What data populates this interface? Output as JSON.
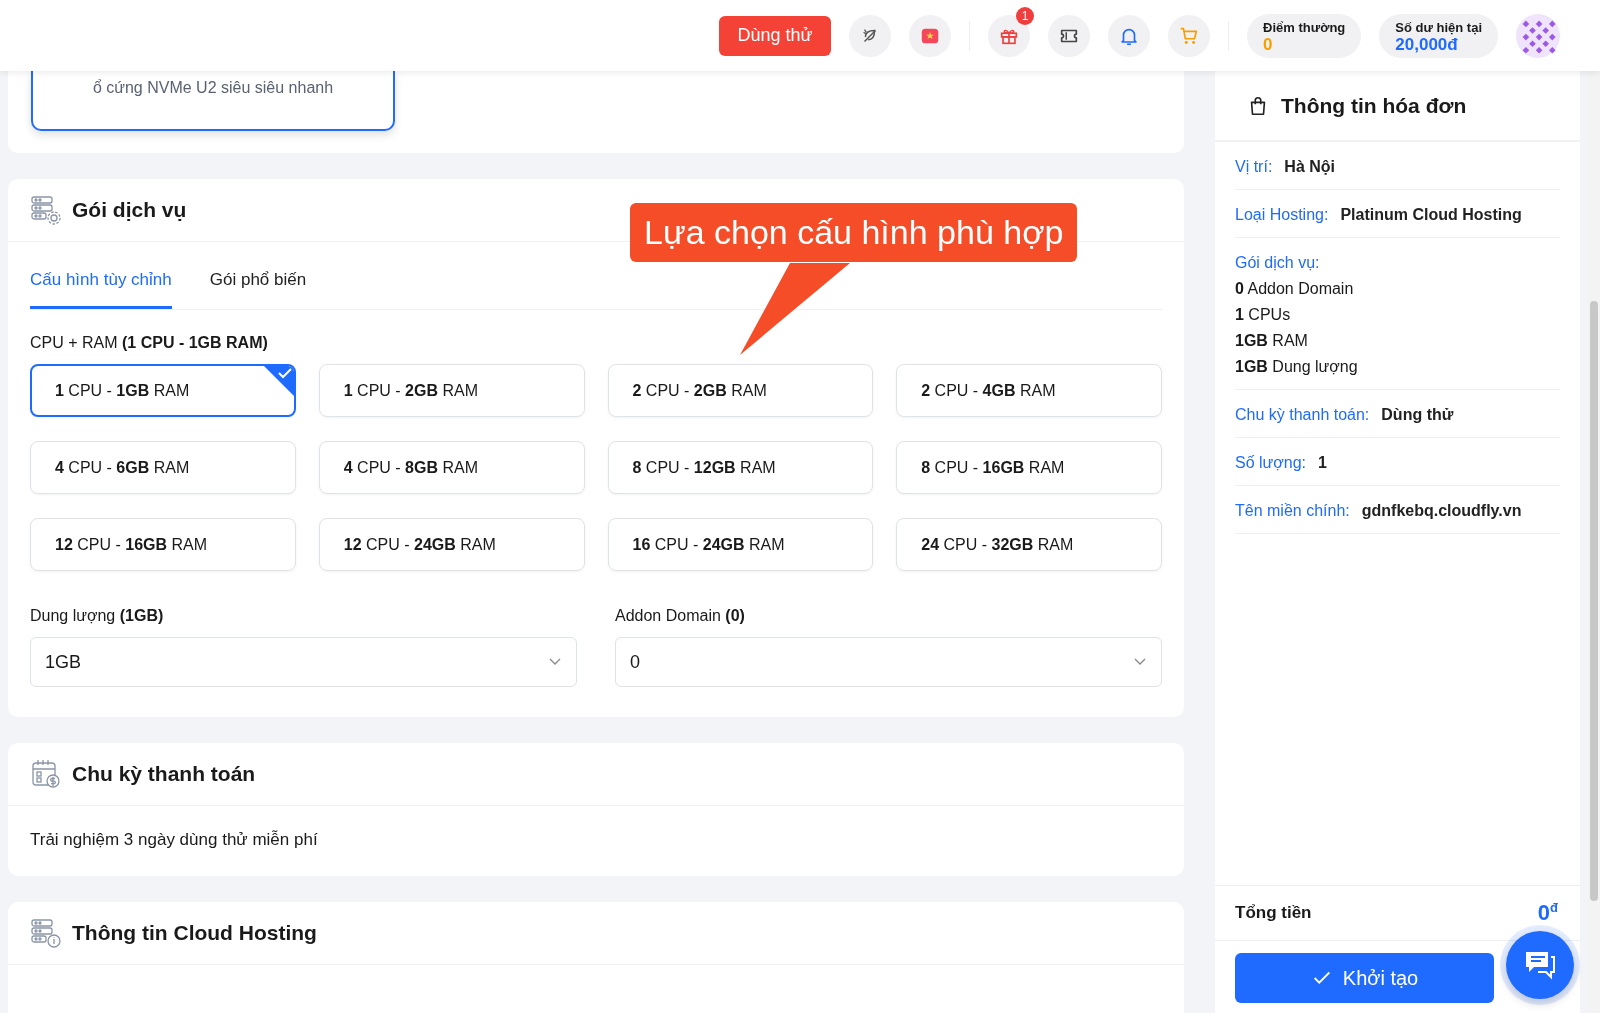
{
  "header": {
    "trial_button": "Dùng thử",
    "gift_badge": "1",
    "points": {
      "label": "Điểm thường",
      "value": "0"
    },
    "balance": {
      "label": "Số dư hiện tại",
      "value": "20,000đ"
    }
  },
  "top_card": {
    "description": "ổ cứng NVMe U2 siêu siêu nhanh"
  },
  "service_package": {
    "title": "Gói dịch vụ",
    "tabs": [
      {
        "label": "Cấu hình tùy chỉnh",
        "selected": true
      },
      {
        "label": "Gói phổ biến",
        "selected": false
      }
    ],
    "cpu_ram_label": "CPU + RAM **(1 CPU - 1GB RAM)**",
    "options": [
      {
        "label": "**1** CPU - **1GB** RAM",
        "selected": true
      },
      {
        "label": "**1** CPU - **2GB** RAM",
        "selected": false
      },
      {
        "label": "**2** CPU - **2GB** RAM",
        "selected": false
      },
      {
        "label": "**2** CPU - **4GB** RAM",
        "selected": false
      },
      {
        "label": "**4** CPU - **6GB** RAM",
        "selected": false
      },
      {
        "label": "**4** CPU - **8GB** RAM",
        "selected": false
      },
      {
        "label": "**8** CPU - **12GB** RAM",
        "selected": false
      },
      {
        "label": "**8** CPU - **16GB** RAM",
        "selected": false
      },
      {
        "label": "**12** CPU - **16GB** RAM",
        "selected": false
      },
      {
        "label": "**12** CPU - **24GB** RAM",
        "selected": false
      },
      {
        "label": "**16** CPU - **24GB** RAM",
        "selected": false
      },
      {
        "label": "**24** CPU - **32GB** RAM",
        "selected": false
      }
    ],
    "storage": {
      "label": "Dung lượng **(1GB)**",
      "value": "1GB"
    },
    "addon": {
      "label": "Addon Domain **(0)**",
      "value": "0"
    }
  },
  "callout": "Lựa chọn cấu hình phù hợp",
  "billing_cycle": {
    "title": "Chu kỳ thanh toán",
    "text": "Trải nghiệm 3 ngày dùng thử miễn phí"
  },
  "hosting_info": {
    "title": "Thông tin Cloud Hosting"
  },
  "invoice": {
    "title": "Thông tin hóa đơn",
    "rows": [
      {
        "label": "Vị trí:",
        "value": "Hà Nội"
      },
      {
        "label": "Loại Hosting:",
        "value": "Platinum Cloud Hosting"
      },
      {
        "label": "Gói dịch vụ:",
        "lines": [
          "**0** Addon Domain",
          "**1** CPUs",
          "**1GB** RAM",
          "**1GB** Dung lượng"
        ]
      },
      {
        "label": "Chu kỳ thanh toán:",
        "value": "Dùng thử"
      },
      {
        "label": "Số lượng:",
        "value": "1"
      },
      {
        "label": "Tên miền chính:",
        "value": "gdnfkebq.cloudfly.vn"
      }
    ],
    "total_label": "Tổng tiền",
    "total_value": "0",
    "currency": "đ",
    "submit": "Khởi tạo"
  }
}
